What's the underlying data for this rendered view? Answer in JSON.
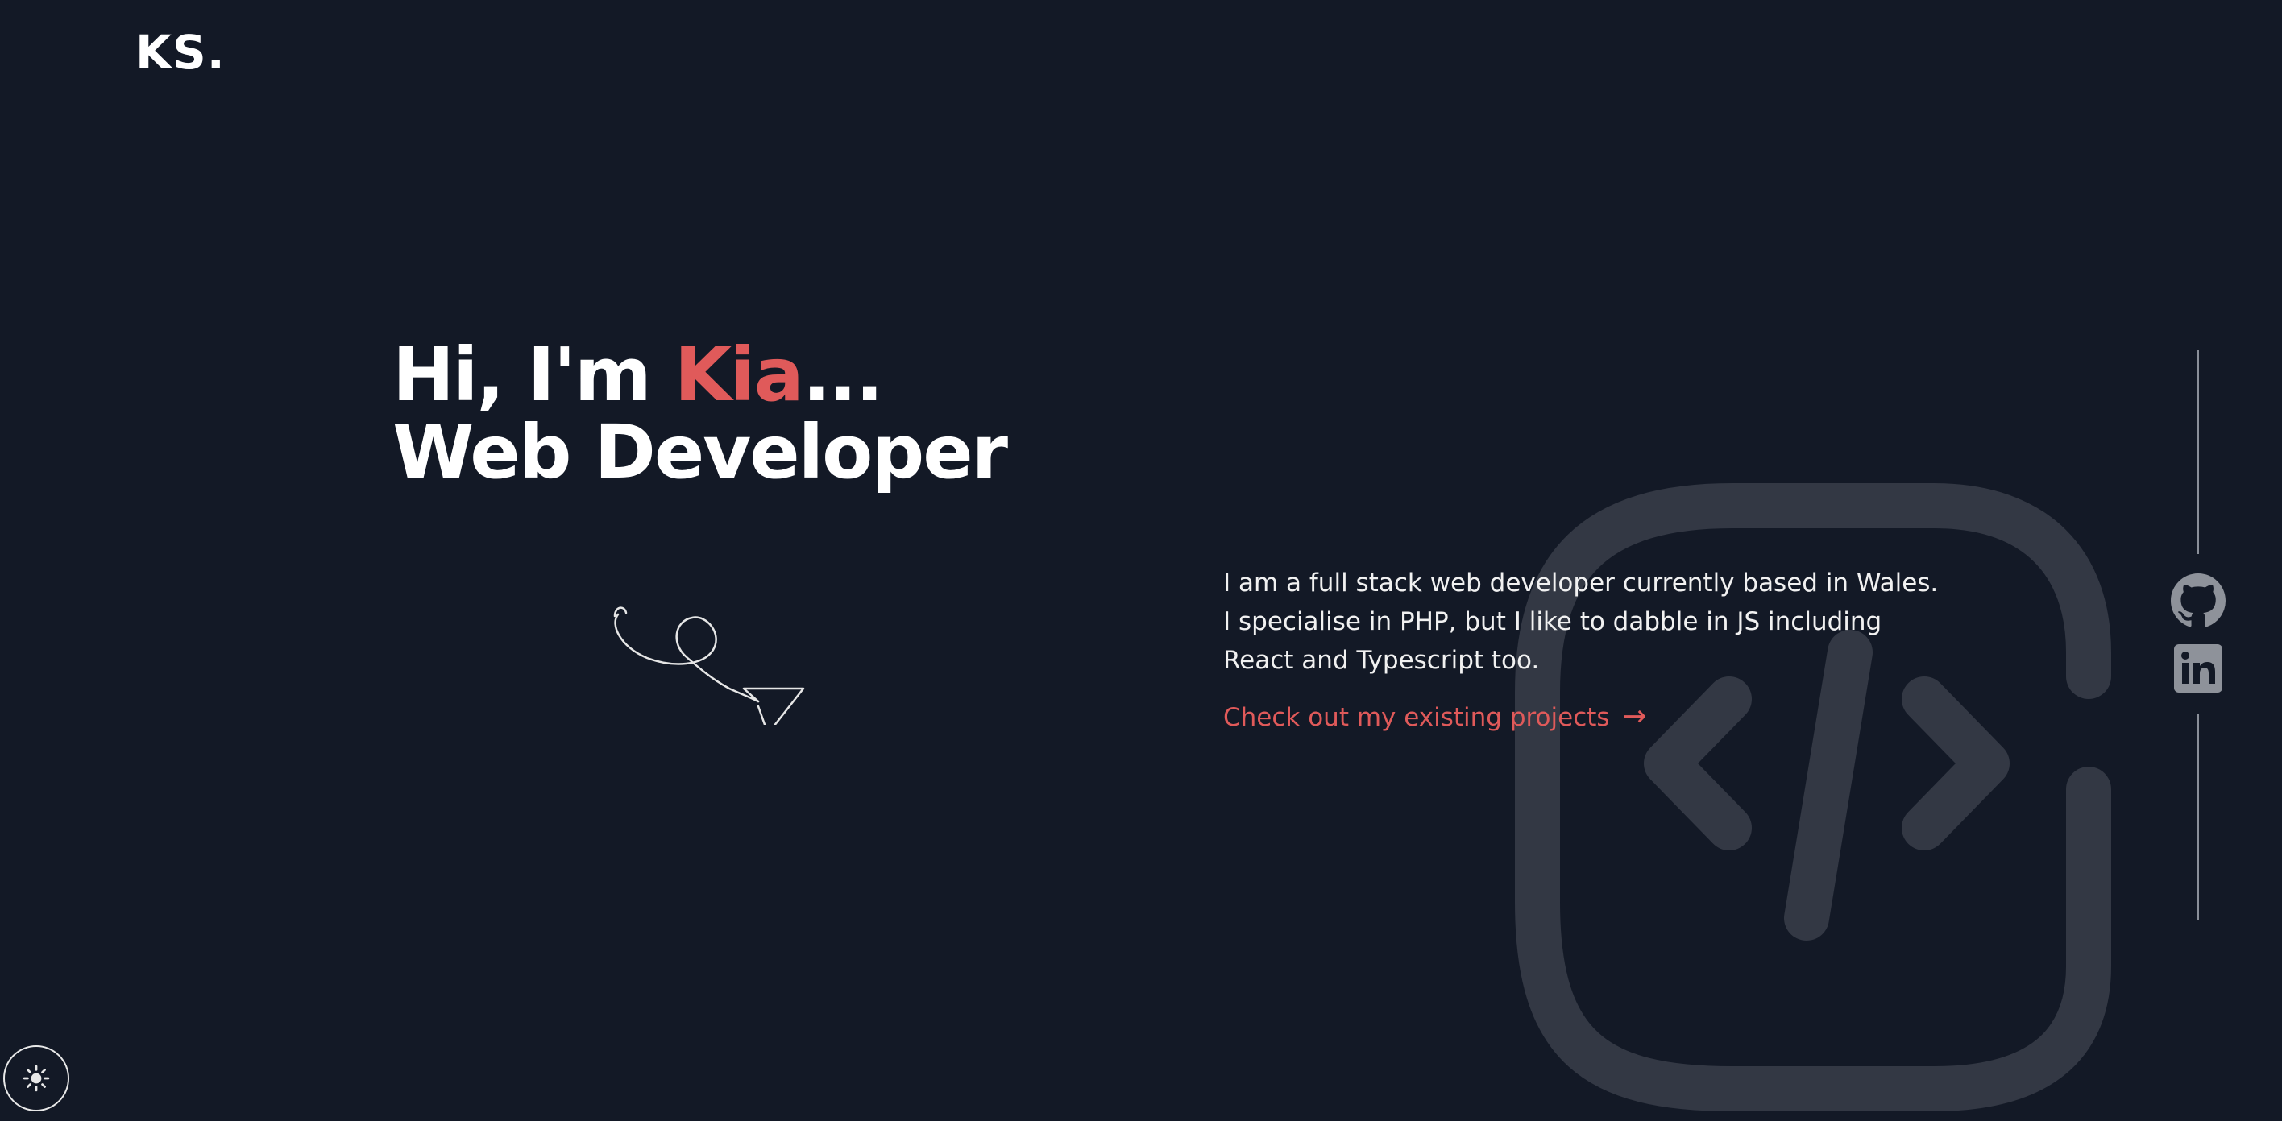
{
  "header": {
    "logo_text": "KS."
  },
  "hero": {
    "greeting_prefix": "Hi, I'm ",
    "name": "Kia",
    "greeting_suffix": "...",
    "role": "Web Developer"
  },
  "intro": {
    "line1": "I am a full stack web developer currently based in Wales.",
    "line2": "I specialise in PHP, but I like to dabble in JS including",
    "line3": "React and Typescript too.",
    "projects_link": "Check out my existing projects",
    "projects_arrow": "→"
  },
  "social": {
    "github_icon": "github-icon",
    "linkedin_icon": "linkedin-icon"
  },
  "theme_toggle": {
    "icon": "sun-icon"
  },
  "colors": {
    "background": "#131926",
    "accent": "#e05a5a",
    "text": "#ffffff",
    "icon_muted": "#3a3e48"
  }
}
